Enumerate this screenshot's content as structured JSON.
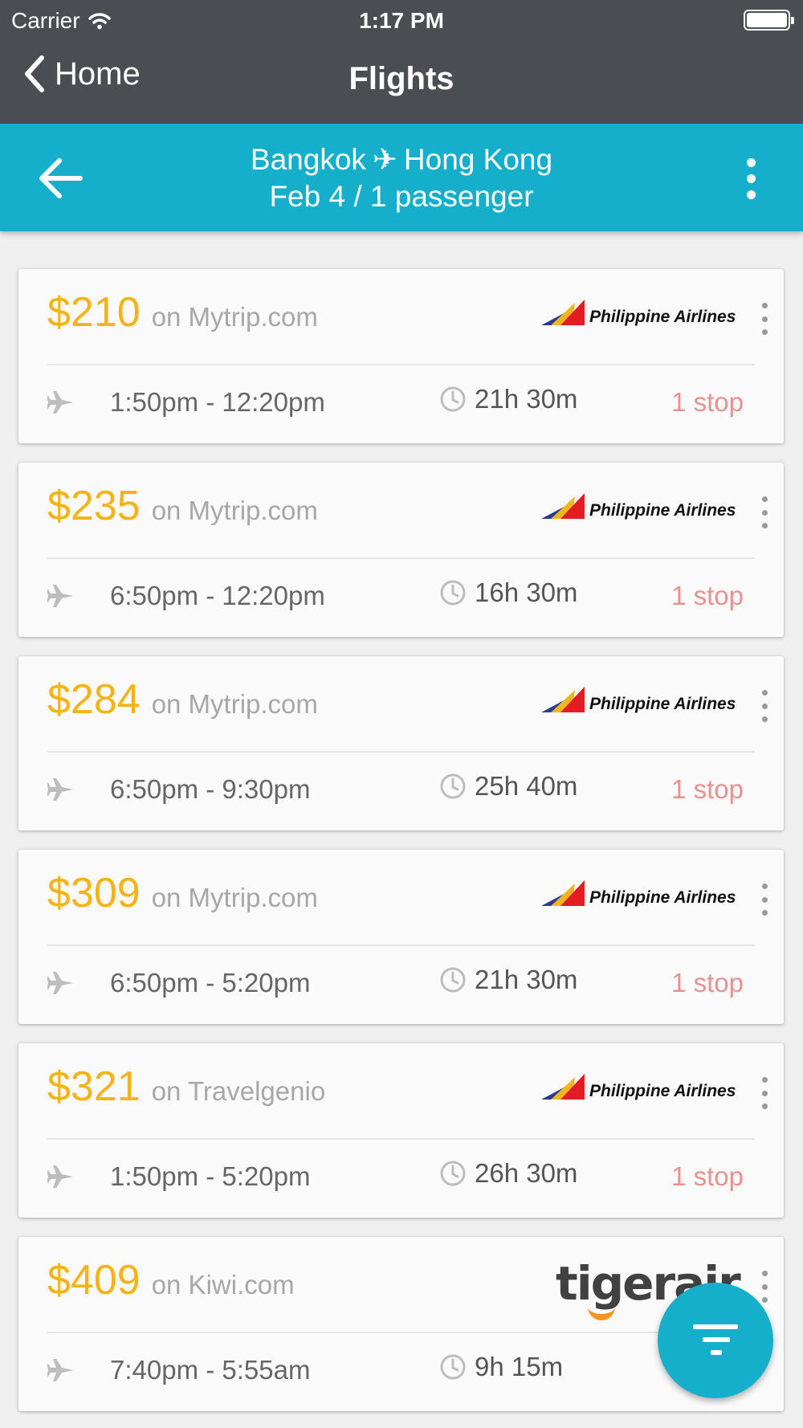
{
  "status_bar": {
    "carrier": "Carrier",
    "time": "1:17 PM"
  },
  "nav": {
    "back_label": "Home",
    "title": "Flights"
  },
  "search": {
    "origin": "Bangkok",
    "destination": "Hong Kong",
    "plane_glyph": "✈",
    "details": "Feb 4 / 1 passenger"
  },
  "colors": {
    "accent": "#16afcb",
    "price": "#f6b317",
    "stops": "#e99090",
    "nav": "#4a4d51"
  },
  "results": [
    {
      "price": "$210",
      "vendor": "on Mytrip.com",
      "airline": "Philippine Airlines",
      "times": "1:50pm - 12:20pm",
      "duration": "21h 30m",
      "stops": "1 stop"
    },
    {
      "price": "$235",
      "vendor": "on Mytrip.com",
      "airline": "Philippine Airlines",
      "times": "6:50pm - 12:20pm",
      "duration": "16h 30m",
      "stops": "1 stop"
    },
    {
      "price": "$284",
      "vendor": "on Mytrip.com",
      "airline": "Philippine Airlines",
      "times": "6:50pm - 9:30pm",
      "duration": "25h 40m",
      "stops": "1 stop"
    },
    {
      "price": "$309",
      "vendor": "on Mytrip.com",
      "airline": "Philippine Airlines",
      "times": "6:50pm - 5:20pm",
      "duration": "21h 30m",
      "stops": "1 stop"
    },
    {
      "price": "$321",
      "vendor": "on Travelgenio",
      "airline": "Philippine Airlines",
      "times": "1:50pm - 5:20pm",
      "duration": "26h 30m",
      "stops": "1 stop"
    },
    {
      "price": "$409",
      "vendor": "on Kiwi.com",
      "airline": "tigerair",
      "times": "7:40pm - 5:55am",
      "duration": "9h 15m",
      "stops": ""
    }
  ],
  "icons": {
    "back": "chevron-left-icon",
    "arrow": "arrow-left-icon",
    "more": "more-vertical-icon",
    "plane": "plane-icon",
    "clock": "clock-icon",
    "filter": "filter-icon"
  }
}
